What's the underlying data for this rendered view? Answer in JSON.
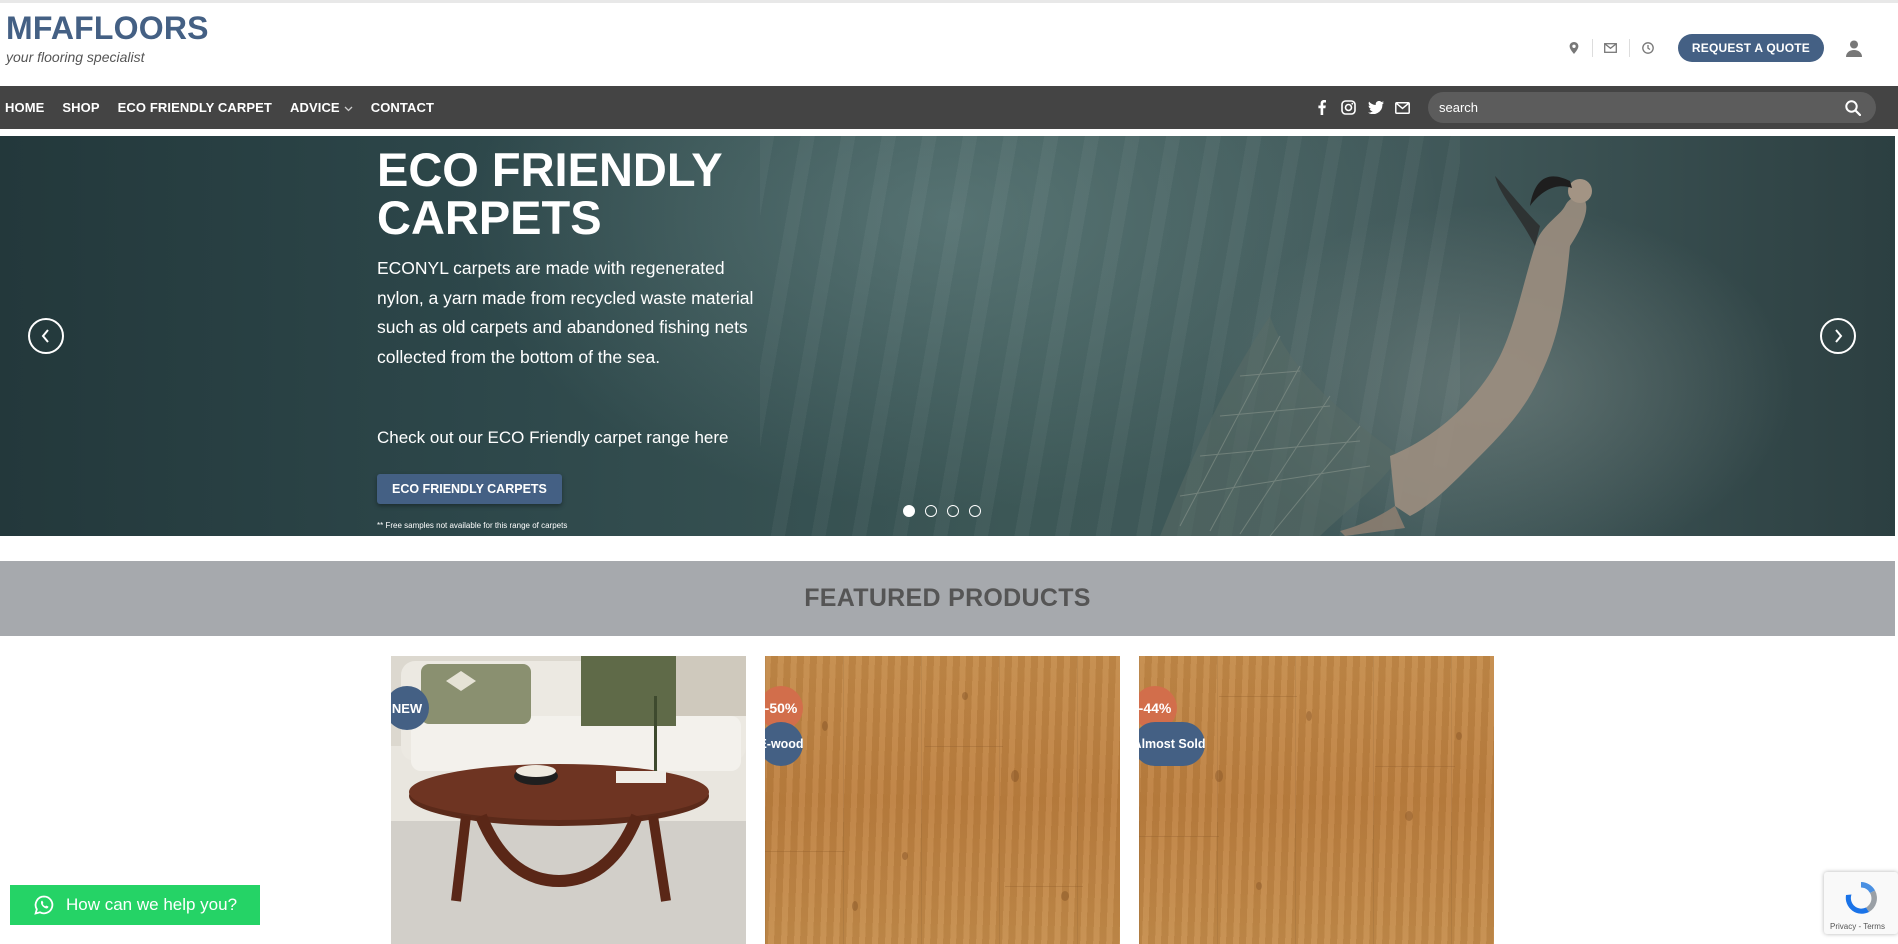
{
  "header": {
    "logo_title": "MFAFLOORS",
    "logo_tagline": "your flooring specialist",
    "icons": [
      "map-pin-icon",
      "envelope-icon",
      "clock-icon"
    ],
    "quote_button": "REQUEST A QUOTE",
    "account_icon": "user-icon"
  },
  "nav": {
    "items": [
      {
        "label": "HOME"
      },
      {
        "label": "SHOP"
      },
      {
        "label": "ECO FRIENDLY CARPET"
      },
      {
        "label": "ADVICE",
        "has_dropdown": true
      },
      {
        "label": "CONTACT"
      }
    ],
    "social_icons": [
      "facebook-icon",
      "instagram-icon",
      "twitter-icon",
      "email-icon"
    ],
    "search_placeholder": "search"
  },
  "hero": {
    "title": "ECO FRIENDLY CARPETS",
    "body": "ECONYL carpets are made with regenerated nylon, a yarn made from recycled waste material such as old carpets and abandoned fishing nets collected from the bottom of the sea.",
    "cta_text": "Check out our ECO Friendly carpet range here",
    "button": "ECO FRIENDLY CARPETS",
    "note": "** Free samples not available for this range of carpets",
    "slides": 4,
    "active_slide": 1
  },
  "featured": {
    "title": "FEATURED PRODUCTS",
    "products": [
      {
        "badges": [
          "NEW"
        ]
      },
      {
        "badges": [
          "-50%",
          "E-wood"
        ]
      },
      {
        "badges": [
          "-44%",
          "Almost Sold"
        ]
      }
    ]
  },
  "help_widget": {
    "label": "How can we help you?"
  },
  "recaptcha": {
    "label": "Privacy - Terms"
  },
  "colors": {
    "brand_blue": "#446084",
    "nav_bg": "#444444",
    "sale_orange": "#d26e4b",
    "whatsapp_green": "#25d366",
    "featured_bg": "#a6a9ad"
  }
}
